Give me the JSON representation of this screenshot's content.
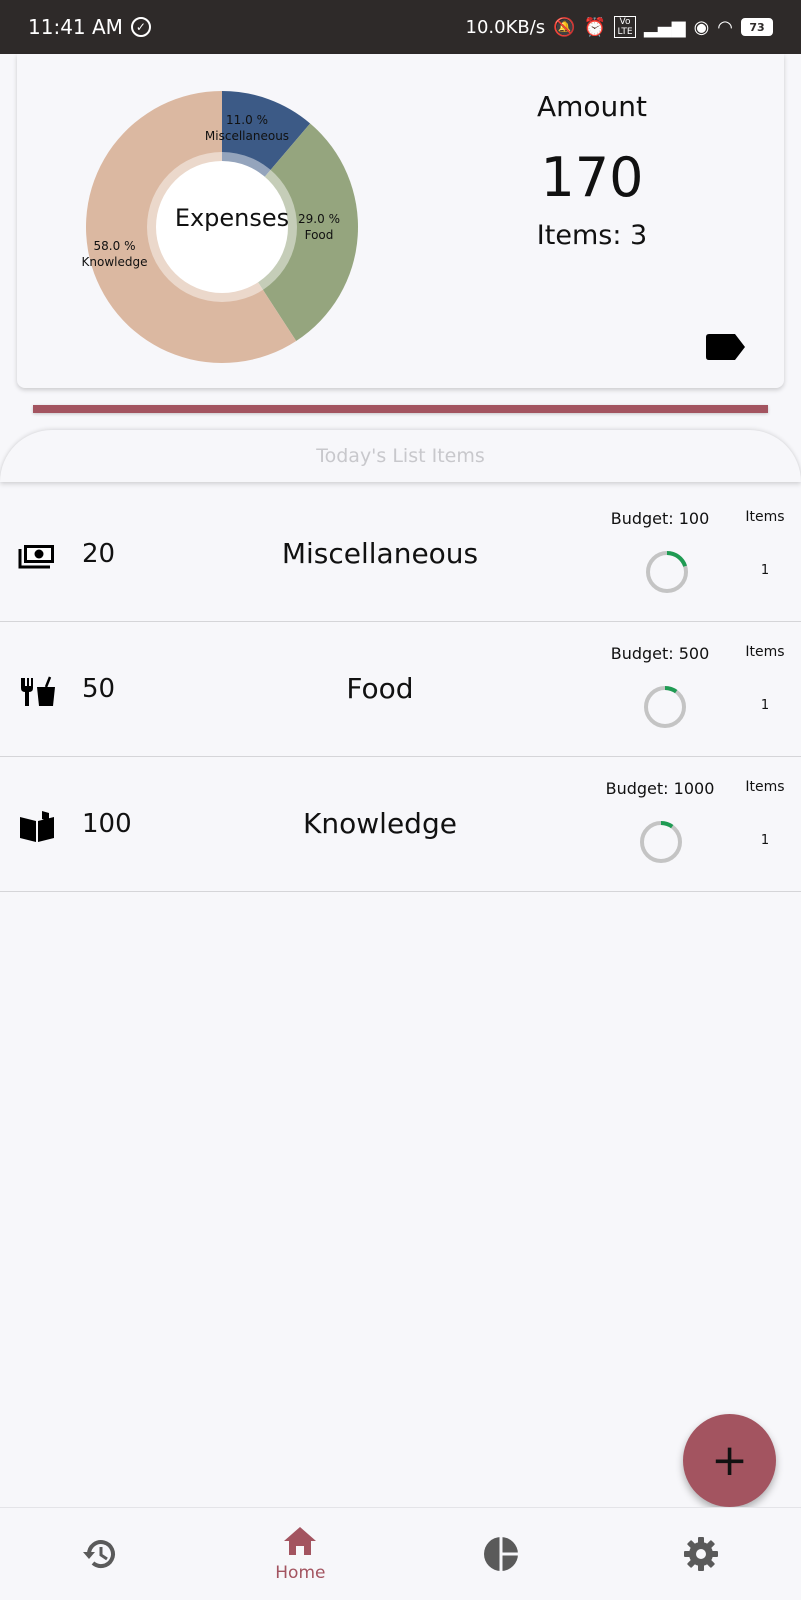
{
  "status_bar": {
    "time": "11:41 AM",
    "net_speed": "10.0KB/s",
    "volte": "Vo LTE",
    "battery": "73"
  },
  "summary": {
    "chart_data": {
      "type": "pie",
      "title": "Expenses",
      "categories": [
        "Miscellaneous",
        "Food",
        "Knowledge"
      ],
      "values": [
        11.0,
        29.0,
        58.0
      ],
      "labels": [
        "11.0 %",
        "29.0 %",
        "58.0 %"
      ],
      "colors": [
        "#3c5a86",
        "#95a57e",
        "#dbb8a1"
      ]
    },
    "amount_title": "Amount",
    "amount_value": "170",
    "items_count": "Items: 3"
  },
  "strip_color": "#a35460",
  "list": {
    "header": "Today's List Items",
    "rows": [
      {
        "icon": "money-icon",
        "amount": "20",
        "category": "Miscellaneous",
        "budget": "Budget: 100",
        "items_label": "Items",
        "items_value": "1",
        "budget_used": 0.2
      },
      {
        "icon": "food-icon",
        "amount": "50",
        "category": "Food",
        "budget": "Budget: 500",
        "items_label": "Items",
        "items_value": "1",
        "budget_used": 0.1
      },
      {
        "icon": "book-icon",
        "amount": "100",
        "category": "Knowledge",
        "budget": "Budget: 1000",
        "items_label": "Items",
        "items_value": "1",
        "budget_used": 0.1
      }
    ]
  },
  "fab": {
    "label": "+"
  },
  "nav": {
    "items": [
      {
        "icon": "history-icon",
        "label": ""
      },
      {
        "icon": "home-icon",
        "label": "Home"
      },
      {
        "icon": "pie-chart-icon",
        "label": ""
      },
      {
        "icon": "settings-icon",
        "label": ""
      }
    ]
  }
}
